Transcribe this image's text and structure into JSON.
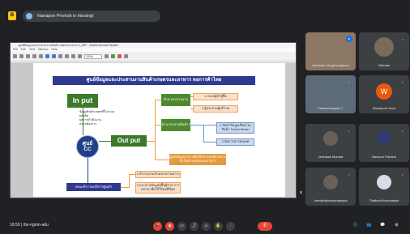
{
  "meeting": {
    "badge": "B",
    "title": "Nanapon Promsit is missing!",
    "time": "16:50",
    "code": "rbx-ngmn-adu"
  },
  "pdf": {
    "window_title": "ศูนย์ข้อมูลและประสานงานสินค้าเกษตรและอาหาร_DSF - Adobe Acrobat Reader",
    "menu": "File Edit View Window Help",
    "zoom": "103%"
  },
  "slide": {
    "title": "ศูนย์ข้อมูลและประสานงานสินค้าเกษตรและอาหาร หอการค้าไทย",
    "input": "In put",
    "input_items": [
      "ข้อมูลสินค้าเกษตรที่ในระบบ",
      "ผลผลิต",
      "ผลการดำเนินงาน",
      "ความต้องการ"
    ],
    "center_line1": "ศูนย์",
    "center_line2": "CC",
    "output": "Out put",
    "g1": "ด้าน ประสานงาน",
    "g2": "ด้าน ประสานสินค้าฯ",
    "o1": "1.ระบบผู้ค้าผู้ซื้อ",
    "o2": "2.ผู้ประสานผู้บริโภค",
    "b1": "1.จัดทำข้อมูลเชื่อมโยงสินค้า Social Model",
    "b2": "2.จัดการสารสนเทศ",
    "data_box": "ศูนย์ข้อมูลกลาง เพื่อใช้ประโยชน์ทางการค้าสินค้าเกษตรและอาหาร",
    "blue_bar": "คณะทำงานบริหารศูนย์ฯ",
    "r1": "1.ทำงานร่วมกับหน่วยงานต่างๆ",
    "r2": "2.ประสานข้อมูลผู้ซื้อผู้ขาย การตลาด เพื่อให้ได้ผลดีที่สุด"
  },
  "participants": [
    {
      "name": "Jeerasak Limpphonganun",
      "kind": "camera",
      "mic": "on"
    },
    {
      "name": "Vietnam",
      "kind": "photo",
      "mic": "off"
    },
    {
      "name": "Chainarongsak C.",
      "kind": "camera",
      "mic": "off"
    },
    {
      "name": "Wanaporn Nora",
      "kind": "letter",
      "letter": "W",
      "mic": "off"
    },
    {
      "name": "Jeerasak Monnat",
      "kind": "photo",
      "mic": "off"
    },
    {
      "name": "Nampon Panana",
      "kind": "photo",
      "mic": "off"
    },
    {
      "name": "Jeerakhitphuuphaaiaao",
      "kind": "photo",
      "mic": "off"
    },
    {
      "name": "Thailand Association",
      "kind": "photo",
      "mic": "off"
    }
  ],
  "controls": {
    "mic": "🎤",
    "cam": "◉",
    "cc": "▭",
    "present": "⤴",
    "react": "☺",
    "hand": "✋",
    "more": "⋮",
    "end": "✆",
    "info": "ⓘ",
    "people": "👥",
    "chat": "💬",
    "activities": "⊞"
  }
}
